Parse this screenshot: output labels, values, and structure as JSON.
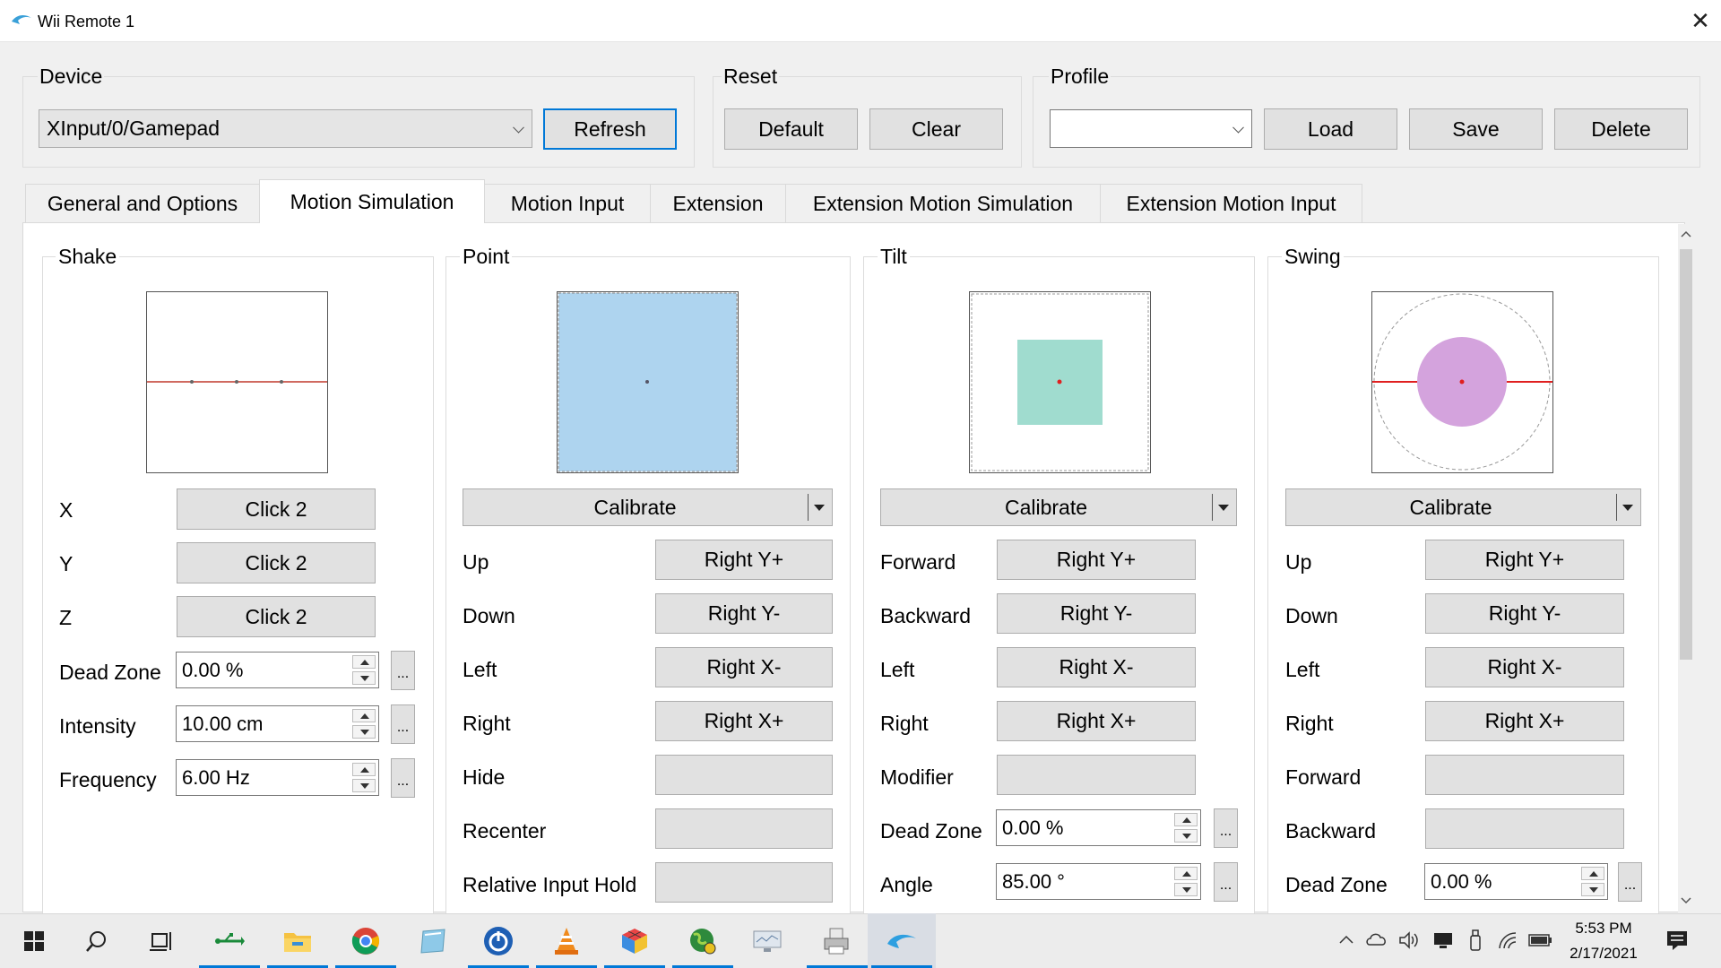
{
  "window": {
    "title": "Wii Remote 1",
    "close_glyph": "✕"
  },
  "device": {
    "group_label": "Device",
    "selected": "XInput/0/Gamepad",
    "refresh": "Refresh"
  },
  "reset": {
    "group_label": "Reset",
    "default": "Default",
    "clear": "Clear"
  },
  "profile": {
    "group_label": "Profile",
    "selected": "",
    "load": "Load",
    "save": "Save",
    "delete": "Delete"
  },
  "tabs": [
    "General and Options",
    "Motion Simulation",
    "Motion Input",
    "Extension",
    "Extension Motion Simulation",
    "Extension Motion Input"
  ],
  "active_tab": "Motion Simulation",
  "shake": {
    "label": "Shake",
    "rows": [
      {
        "label": "X",
        "value": "Click 2"
      },
      {
        "label": "Y",
        "value": "Click 2"
      },
      {
        "label": "Z",
        "value": "Click 2"
      }
    ],
    "dead_zone": {
      "label": "Dead Zone",
      "value": "0.00 %"
    },
    "intensity": {
      "label": "Intensity",
      "value": "10.00 cm"
    },
    "frequency": {
      "label": "Frequency",
      "value": "6.00 Hz"
    }
  },
  "point": {
    "label": "Point",
    "calibrate": "Calibrate",
    "rows": [
      {
        "label": "Up",
        "value": "Right Y+"
      },
      {
        "label": "Down",
        "value": "Right Y-"
      },
      {
        "label": "Left",
        "value": "Right X-"
      },
      {
        "label": "Right",
        "value": "Right X+"
      },
      {
        "label": "Hide",
        "value": ""
      },
      {
        "label": "Recenter",
        "value": ""
      },
      {
        "label": "Relative Input Hold",
        "value": ""
      }
    ],
    "viz_color": "#aed4ef"
  },
  "tilt": {
    "label": "Tilt",
    "calibrate": "Calibrate",
    "rows": [
      {
        "label": "Forward",
        "value": "Right Y+"
      },
      {
        "label": "Backward",
        "value": "Right Y-"
      },
      {
        "label": "Left",
        "value": "Right X-"
      },
      {
        "label": "Right",
        "value": "Right X+"
      },
      {
        "label": "Modifier",
        "value": ""
      }
    ],
    "dead_zone": {
      "label": "Dead Zone",
      "value": "0.00 %"
    },
    "angle": {
      "label": "Angle",
      "value": "85.00 °"
    },
    "viz_color": "#a0dccf"
  },
  "swing": {
    "label": "Swing",
    "calibrate": "Calibrate",
    "rows": [
      {
        "label": "Up",
        "value": "Right Y+"
      },
      {
        "label": "Down",
        "value": "Right Y-"
      },
      {
        "label": "Left",
        "value": "Right X-"
      },
      {
        "label": "Right",
        "value": "Right X+"
      },
      {
        "label": "Forward",
        "value": ""
      },
      {
        "label": "Backward",
        "value": ""
      }
    ],
    "dead_zone": {
      "label": "Dead Zone",
      "value": "0.00 %"
    },
    "viz_color": "#d4a3dd"
  },
  "dots_label": "...",
  "taskbar": {
    "icons": [
      "windows-start-icon",
      "search-icon",
      "task-view-icon",
      "usb-app-icon",
      "file-explorer-icon",
      "chrome-icon",
      "notepad-app-icon",
      "power-app-icon",
      "vlc-icon",
      "cube-app-icon",
      "globe-app-icon",
      "monitor-app-icon",
      "printer-app-icon",
      "dolphin-icon"
    ],
    "time": "5:53 PM",
    "date": "2/17/2021"
  }
}
